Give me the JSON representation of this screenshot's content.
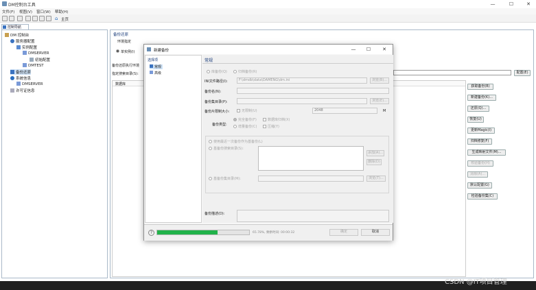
{
  "window": {
    "title": "DM控制台工具",
    "min": "—",
    "max": "☐",
    "close": "✕"
  },
  "menu": [
    "文件(F)",
    "视图(V)",
    "窗口(W)",
    "帮助(H)"
  ],
  "toolbar": {
    "home_label": "主页"
  },
  "nav": {
    "tab_label": "控制导航",
    "tree": [
      "DM 控制台",
      "服务器配置",
      "实例配置",
      "DMSERVER",
      "初始配置",
      "DMTEST",
      "备份还原",
      "系统信息",
      "DMSERVER",
      "许可证信息"
    ]
  },
  "main": {
    "section_title": "备份还原",
    "instance_label": "环境指定",
    "radio_instance": "单实例(I)",
    "row1_label": "备份还原执行环境",
    "row2_label": "指定搜索目录(S):",
    "config_btn": "配置(E)",
    "col_header": "数据库",
    "side_buttons": [
      "获取备份(B)",
      "新建备份(K)...",
      "还原(Q)...",
      "恢复(U)",
      "更新Magic(I)",
      "归档修复(F)",
      "生成映射文件(M)...",
      "校验备份(H)",
      "清除(A)...",
      "默认配置(G)",
      "检验备份集(C)"
    ]
  },
  "dialog": {
    "title": "新建备份",
    "tree_root": "选择项",
    "tree_items": [
      "常规",
      "高级"
    ],
    "panel_title": "常规",
    "backup_mode": {
      "label_db": "库备份(Q)",
      "label_archive": "归档备份(R)"
    },
    "ini_label": "INI文件路径(I):",
    "ini_value": "F:\\dmdb\\data\\DAMENG\\dm.ini",
    "browse_btn": "浏览(B)...",
    "name_label": "备份名(N):",
    "set_dir_label": "备份集目录(P):",
    "browse2_btn": "浏览(E)...",
    "piece_label": "备份片限制大小:",
    "unlimited_label": "无限制(U)",
    "piece_value": "2048",
    "piece_unit": "M",
    "type_label": "备份类型:",
    "full_label": "完全备份(F)",
    "incr_label": "增量备份(C)",
    "delete_label": "数据库归档(X)",
    "compress_label": "压缩(Y)",
    "base_opt1": "使用最近一次备份作为基备份(L)",
    "base_opt2": "基备份搜索目录(S):",
    "add_btn": "添加(A)...",
    "del_btn": "删除(D)",
    "base_opt3": "基备份集目录(M):",
    "browse3_btn": "浏览(T)...",
    "desc_label": "备份描述(D):",
    "progress_pct": 65.78,
    "progress_text": "65.78%, 剩余时间: 00:00:32",
    "ok_btn": "确定",
    "cancel_btn": "取消",
    "help_icon": "?"
  },
  "watermark": "CSDN @IT项目管理",
  "colors": {
    "progress": "#21b24a",
    "section": "#1a3c7a",
    "tree_sel": "#cfe3f7"
  }
}
